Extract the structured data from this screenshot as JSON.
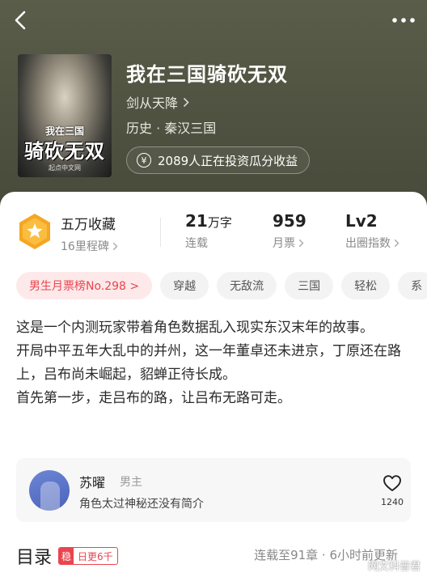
{
  "header": {
    "book_title": "我在三国骑砍无双",
    "author": "剑从天降",
    "genre": "历史 · 秦汉三国",
    "invest_text": "2089人正在投资瓜分收益",
    "cover": {
      "title_small": "我在三国",
      "title_big": "骑砍无双",
      "publisher": "起点中文网"
    }
  },
  "stats": {
    "favorites": "五万收藏",
    "reputation": "16里程碑",
    "words_num": "21",
    "words_unit": "万字",
    "words_label": "连载",
    "votes_num": "959",
    "votes_label": "月票",
    "level_num": "Lv2",
    "level_label": "出圈指数"
  },
  "tags": [
    "男生月票榜No.298 >",
    "穿越",
    "无敌流",
    "三国",
    "轻松",
    "系"
  ],
  "description": [
    "这是一个内测玩家带着角色数据乱入现实东汉末年的故事。",
    "开局中平五年大乱中的并州，这一年董卓还未进京，丁原还在路上，吕布尚未崛起，貂蝉正待长成。",
    "首先第一步，走吕布的路，让吕布无路可走。"
  ],
  "comment": {
    "name": "苏曜",
    "role": "男主",
    "text": "角色太过神秘还没有简介",
    "likes": "1240"
  },
  "toc": {
    "title": "目录",
    "daily_icon": "稳",
    "daily_text": "日更6千",
    "status": "连载至91章 · 6小时前更新"
  },
  "watermark": "网文科普君",
  "colors": {
    "accent": "#e9454f",
    "badge": "#f5a623",
    "hero_bg": "#4e513f"
  },
  "icons": {
    "back": "chevron-left-icon",
    "more": "more-dots-icon",
    "yen": "yen-coin-icon",
    "heart": "heart-icon",
    "badge": "star-hexagon-icon"
  }
}
